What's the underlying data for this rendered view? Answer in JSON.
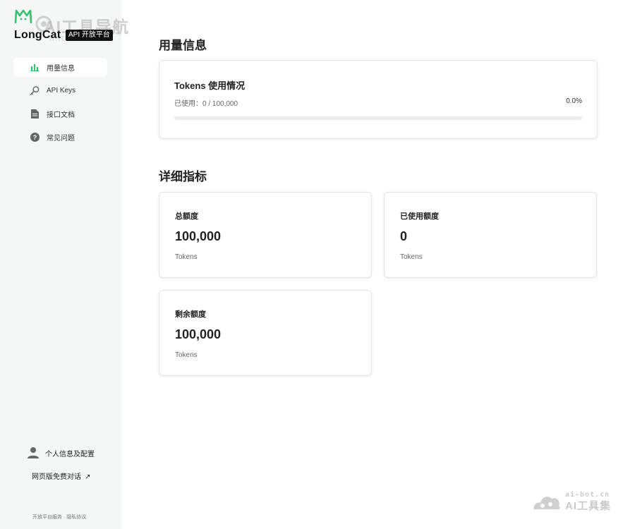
{
  "app": {
    "brand_name": "LongCat",
    "platform_badge": "API 开放平台",
    "accent_color": "#37c26e",
    "watermark_text": "AI工具导航",
    "watermark_sub": "aitoolss.com"
  },
  "sidebar": {
    "items": [
      {
        "label": "用量信息",
        "icon": "bar-chart-icon",
        "active": true
      },
      {
        "label": "API Keys",
        "icon": "key-icon",
        "active": false
      },
      {
        "label": "接口文档",
        "icon": "document-icon",
        "active": false
      },
      {
        "label": "常见问题",
        "icon": "question-icon",
        "active": false
      }
    ],
    "profile_label": "个人信息及配置",
    "web_chat_label": "网页版免费对话",
    "web_chat_arrow": "↗",
    "footer_links": "开放平台服务 · 隐私协议"
  },
  "usage": {
    "section_title": "用量信息",
    "card_title": "Tokens 使用情况",
    "used_text": "已使用：0 / 100,000",
    "percent_text": "0.0%",
    "progress_fraction": 0.0
  },
  "details": {
    "section_title": "详细指标",
    "cards": [
      {
        "title": "总额度",
        "value": "100,000",
        "unit": "Tokens"
      },
      {
        "title": "已使用额度",
        "value": "0",
        "unit": "Tokens"
      },
      {
        "title": "剩余额度",
        "value": "100,000",
        "unit": "Tokens"
      }
    ]
  },
  "corner_watermark": {
    "url": "ai-bot.cn",
    "name": "AI工具集"
  }
}
